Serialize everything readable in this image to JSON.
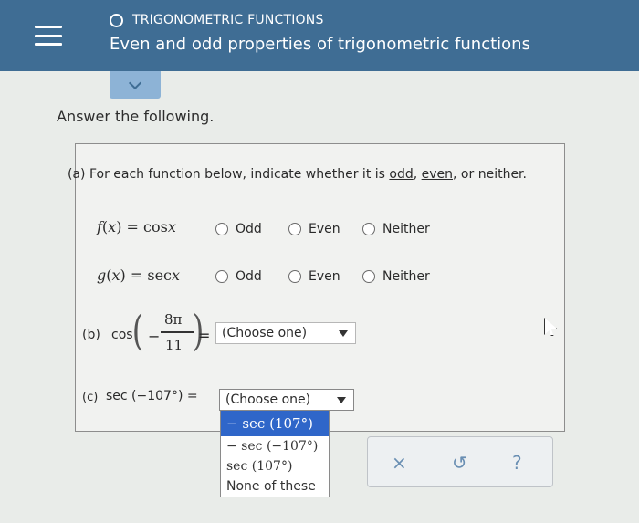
{
  "header": {
    "topic": "TRIGONOMETRIC FUNCTIONS",
    "subtitle": "Even and odd properties of trigonometric functions"
  },
  "prompt": "Answer the following.",
  "part_a": {
    "label_prefix": "(a) For each function below, indicate whether it is ",
    "odd": "odd",
    "comma1": ", ",
    "even": "even",
    "suffix": ", or neither.",
    "functions": [
      {
        "f": "f",
        "x": "x",
        "rhs": "= cos",
        "arg": "x"
      },
      {
        "f": "g",
        "x": "x",
        "rhs": "= sec",
        "arg": "x"
      }
    ],
    "options": [
      "Odd",
      "Even",
      "Neither"
    ]
  },
  "part_b": {
    "label": "(b)",
    "func": "cos",
    "minus": "−",
    "numerator": "8π",
    "denominator": "11",
    "equals": "=",
    "select_value": "(Choose one)"
  },
  "part_c": {
    "label": "(c)",
    "expr": "sec (−107°) =",
    "select_value": "(Choose one)",
    "dropdown_options": [
      "− sec (107°)",
      "− sec (−107°)",
      "sec (107°)",
      "None of these"
    ]
  },
  "actions": {
    "clear": "×",
    "undo": "↺",
    "help": "?"
  }
}
